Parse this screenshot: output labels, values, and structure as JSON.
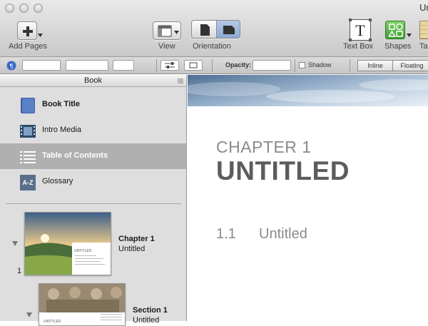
{
  "window": {
    "title": "Un"
  },
  "toolbar": {
    "add_pages_label": "Add Pages",
    "view_label": "View",
    "orientation_label": "Orientation",
    "textbox_label": "Text Box",
    "shapes_label": "Shapes",
    "truncated_label": "Ta"
  },
  "formatbar": {
    "opacity_label": "Opacity:",
    "shadow_label": "Shadow",
    "inline_label": "Inline",
    "floating_label": "Floating"
  },
  "sidebar": {
    "header": "Book",
    "items": [
      {
        "label": "Book Title",
        "icon": "book-icon"
      },
      {
        "label": "Intro Media",
        "icon": "film-icon"
      },
      {
        "label": "Table of Contents",
        "icon": "list-icon",
        "selected": true
      },
      {
        "label": "Glossary",
        "icon": "az-icon",
        "icon_text": "A-Z"
      }
    ],
    "chapters": [
      {
        "number": "1",
        "title": "Chapter 1",
        "subtitle": "Untitled",
        "thumb_text": "UNTITLED"
      },
      {
        "title": "Section 1",
        "subtitle": "Untitled",
        "thumb_text": "UNTITLED"
      }
    ]
  },
  "canvas": {
    "chapter_label": "CHAPTER 1",
    "chapter_title": "UNTITLED",
    "section_number": "1.1",
    "section_title": "Untitled"
  },
  "colors": {
    "selection": "#b0b0b0",
    "accent_blue": "#3b69c6"
  }
}
